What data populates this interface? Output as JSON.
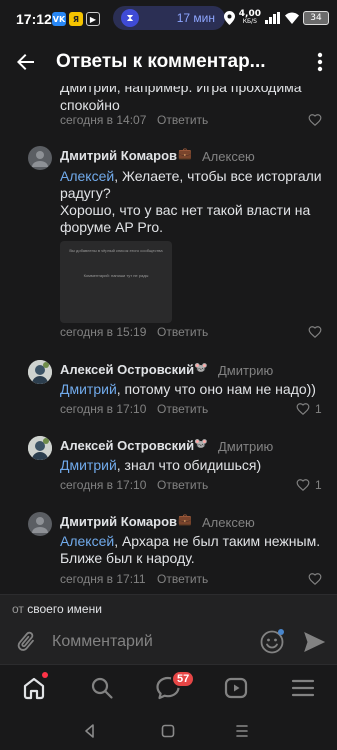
{
  "status_bar": {
    "time": "17:12",
    "apps": [
      {
        "label": "VK",
        "color": "#2787f5"
      },
      {
        "label": "Я",
        "color": "#f5c400"
      },
      {
        "label": "▶",
        "color": "#19191a"
      }
    ],
    "timer": "17 мин",
    "net_speed": "4,00",
    "net_unit": "КБ/S",
    "battery": "34"
  },
  "header": {
    "title": "Ответы к комментар..."
  },
  "partial_comment": {
    "text": "Дмитрий, например. Игра проходима спокойно",
    "date": "сегодня в 14:07",
    "reply_label": "Ответить"
  },
  "comments": [
    {
      "author": "Дмитрий Комаров",
      "badge": "💼",
      "reply_to": "Алексею",
      "mention": "Алексей",
      "text": ", Желаете, чтобы все исторгали радугу?\nХорошо, что у вас нет такой власти на форуме AP Pro.",
      "attachment_line1": "Вы добавлены в чёрный список этого сообщества",
      "attachment_line2": "Комментарий: напиши тут не рады",
      "date": "сегодня в 15:19",
      "reply_label": "Ответить",
      "likes": ""
    },
    {
      "author": "Алексей Островский",
      "badge": "🐭",
      "reply_to": "Дмитрию",
      "mention": "Дмитрий",
      "text": ", потому что оно нам не надо))",
      "date": "сегодня в 17:10",
      "reply_label": "Ответить",
      "likes": "1"
    },
    {
      "author": "Алексей Островский",
      "badge": "🐭",
      "reply_to": "Дмитрию",
      "mention": "Дмитрий",
      "text": ", знал что обидишься)",
      "date": "сегодня в 17:10",
      "reply_label": "Ответить",
      "likes": "1"
    },
    {
      "author": "Дмитрий Комаров",
      "badge": "💼",
      "reply_to": "Алексею",
      "mention": "Алексей",
      "text": ", Архара не был таким нежным. Ближе был к народу.",
      "date": "сегодня в 17:11",
      "reply_label": "Ответить",
      "likes": ""
    }
  ],
  "composer": {
    "from_prefix": "от",
    "from_name": "своего имени",
    "placeholder": "Комментарий"
  },
  "tabbar": {
    "messages_badge": "57"
  },
  "colors": {
    "background": "#19191a",
    "accent": "#71aaeb",
    "secondary_text": "#828282",
    "badge_red": "#e64646"
  }
}
